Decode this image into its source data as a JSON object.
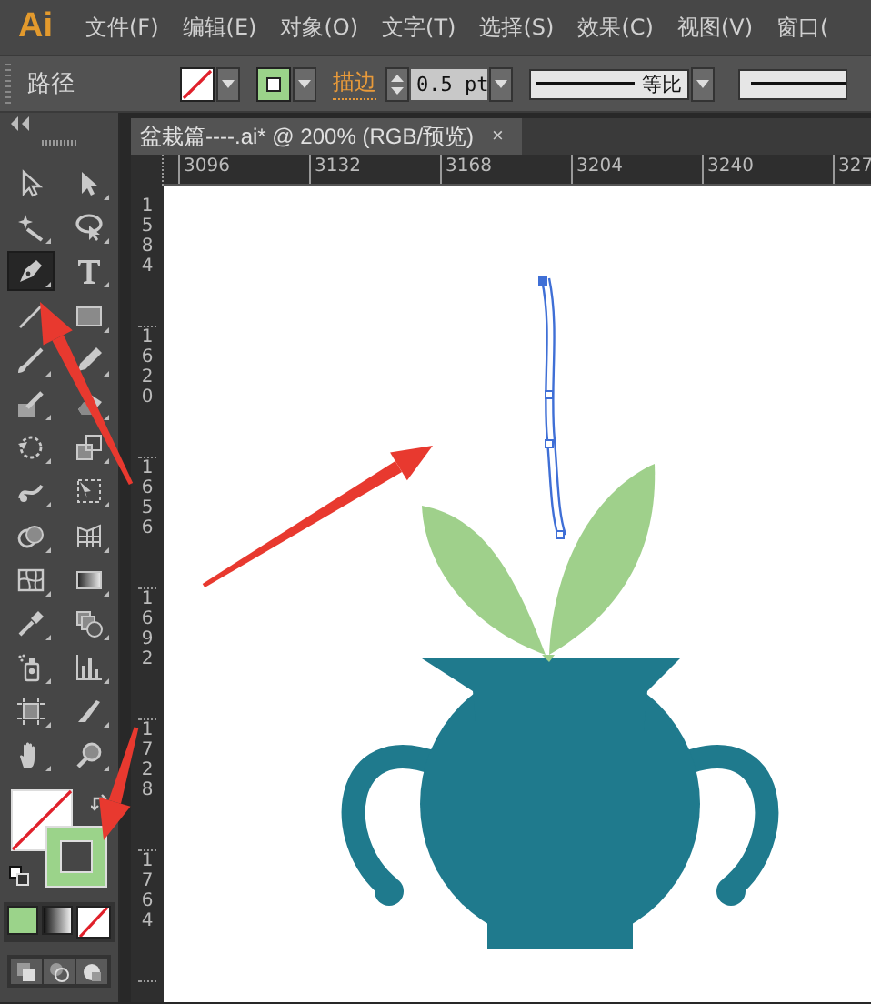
{
  "app": {
    "logo": "Ai"
  },
  "menu": [
    "文件(F)",
    "编辑(E)",
    "对象(O)",
    "文字(T)",
    "选择(S)",
    "效果(C)",
    "视图(V)",
    "窗口("
  ],
  "control_bar": {
    "object_type": "路径",
    "stroke_label": "描边",
    "stroke_weight": "0.5 pt",
    "profile": "等比"
  },
  "tools": [
    {
      "kind": "selection",
      "selected": false
    },
    {
      "kind": "direct-selection",
      "selected": false
    },
    {
      "kind": "magic-wand",
      "selected": false
    },
    {
      "kind": "lasso",
      "selected": false
    },
    {
      "kind": "pen",
      "selected": true
    },
    {
      "kind": "type",
      "selected": false
    },
    {
      "kind": "line",
      "selected": false
    },
    {
      "kind": "rectangle",
      "selected": false
    },
    {
      "kind": "paintbrush",
      "selected": false
    },
    {
      "kind": "pencil",
      "selected": false
    },
    {
      "kind": "blob-brush",
      "selected": false
    },
    {
      "kind": "eraser",
      "selected": false
    },
    {
      "kind": "rotate",
      "selected": false
    },
    {
      "kind": "scale",
      "selected": false
    },
    {
      "kind": "warp",
      "selected": false
    },
    {
      "kind": "free-transform",
      "selected": false
    },
    {
      "kind": "shape-builder",
      "selected": false
    },
    {
      "kind": "perspective-grid",
      "selected": false
    },
    {
      "kind": "mesh",
      "selected": false
    },
    {
      "kind": "gradient",
      "selected": false
    },
    {
      "kind": "eyedropper",
      "selected": false
    },
    {
      "kind": "blend",
      "selected": false
    },
    {
      "kind": "symbol-sprayer",
      "selected": false
    },
    {
      "kind": "column-graph",
      "selected": false
    },
    {
      "kind": "artboard",
      "selected": false
    },
    {
      "kind": "slice",
      "selected": false
    },
    {
      "kind": "hand",
      "selected": false
    },
    {
      "kind": "zoom",
      "selected": false
    }
  ],
  "document_tab": {
    "title": "盆栽篇----.ai* @ 200% (RGB/预览)",
    "close": "×"
  },
  "ruler_horizontal": [
    "3096",
    "3132",
    "3168",
    "3204",
    "3240",
    "327"
  ],
  "ruler_vertical": [
    "1584",
    "1620",
    "1656",
    "1692",
    "1728",
    "1764"
  ]
}
